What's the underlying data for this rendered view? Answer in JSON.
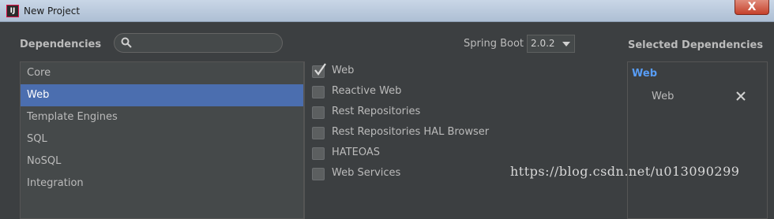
{
  "window": {
    "title": "New Project",
    "close_label": "X"
  },
  "dependencies": {
    "label": "Dependencies",
    "search_placeholder": ""
  },
  "spring_boot": {
    "label": "Spring Boot",
    "selected_version": "2.0.2"
  },
  "categories": [
    {
      "label": "Core",
      "active": false
    },
    {
      "label": "Web",
      "active": true
    },
    {
      "label": "Template Engines",
      "active": false
    },
    {
      "label": "SQL",
      "active": false
    },
    {
      "label": "NoSQL",
      "active": false
    },
    {
      "label": "Integration",
      "active": false
    }
  ],
  "options": [
    {
      "label": "Web",
      "checked": true
    },
    {
      "label": "Reactive Web",
      "checked": false
    },
    {
      "label": "Rest Repositories",
      "checked": false
    },
    {
      "label": "Rest Repositories HAL Browser",
      "checked": false
    },
    {
      "label": "HATEOAS",
      "checked": false
    },
    {
      "label": "Web Services",
      "checked": false
    }
  ],
  "selected_dependencies": {
    "label": "Selected Dependencies",
    "group": "Web",
    "items": [
      "Web"
    ]
  },
  "watermark": "https://blog.csdn.net/u013090299",
  "colors": {
    "accent": "#4b6eaf",
    "group_link": "#589df6",
    "background": "#3c3f41"
  }
}
